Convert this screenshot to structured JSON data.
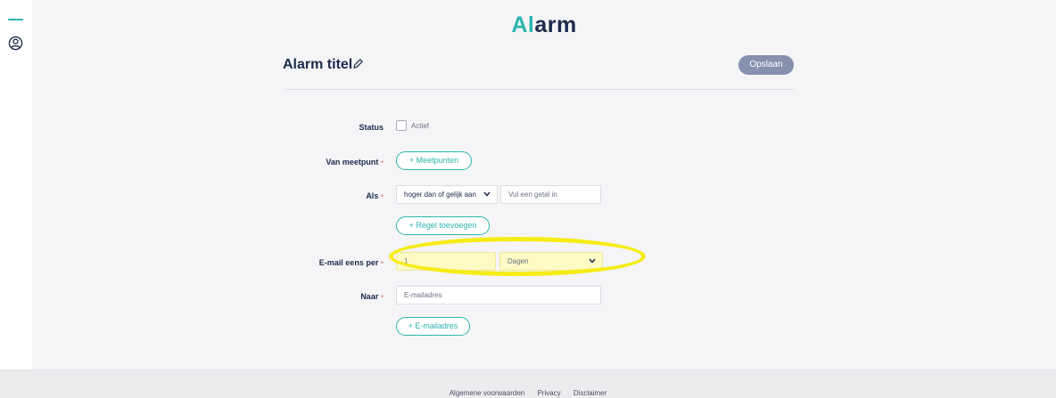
{
  "sidebar": {
    "menu_icon": "menu-line-icon",
    "user_icon": "user-circle-icon"
  },
  "header": {
    "title_part1": "Al",
    "title_part2": "arm"
  },
  "alarm": {
    "title": "Alarm titel",
    "edit_icon": "pencil-icon",
    "save_label": "Opslaan"
  },
  "form": {
    "status": {
      "label": "Status",
      "checkbox_label": "Actief",
      "checked": false
    },
    "meetpunt": {
      "label": "Van meetpunt",
      "required_mark": "•",
      "button": "+ Meetpunten"
    },
    "als": {
      "label": "Als",
      "required_mark": "•",
      "operator": "hoger dan of gelijk aan",
      "value_placeholder": "Vul een getal in",
      "add_rule_button": "+ Regel toevoegen"
    },
    "email_interval": {
      "label": "E-mail eens per",
      "required_mark": "•",
      "value": "1",
      "unit": "Dagen"
    },
    "naar": {
      "label": "Naar",
      "required_mark": "•",
      "placeholder": "E-mailadres",
      "add_button": "+ E-mailadres"
    }
  },
  "highlight": {
    "color": "#f6ec17"
  },
  "colors": {
    "accent": "#2bb5ad",
    "navy": "#1c2b4a",
    "save_button": "#8591ae"
  },
  "footer": {
    "links": [
      "Algemene voorwaarden",
      "Privacy",
      "Disclaimer"
    ]
  }
}
